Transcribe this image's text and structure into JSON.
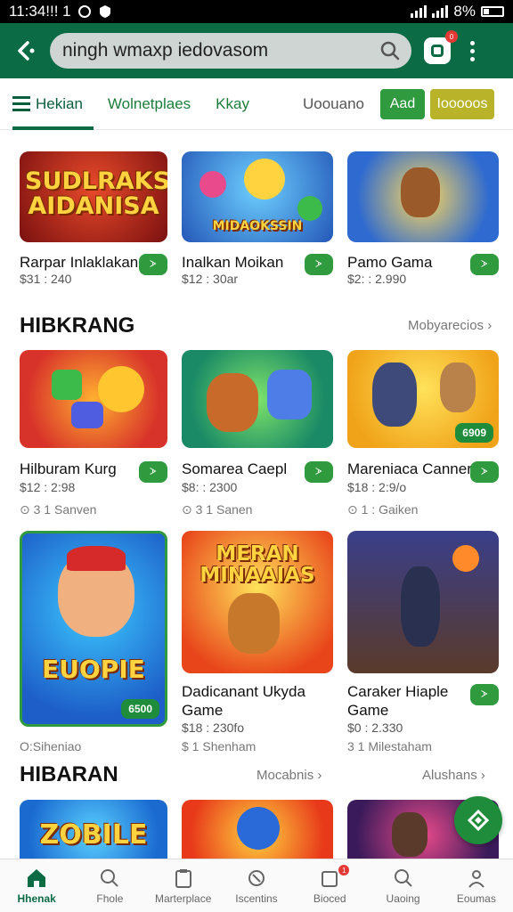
{
  "status_bar": {
    "time": "11:34!!! 1",
    "battery": "8%"
  },
  "search": {
    "value": "ningh wmaxp iedovasom"
  },
  "header": {
    "cart_badge": "0"
  },
  "tabs": [
    {
      "label": "Hekian"
    },
    {
      "label": "Wolnetplaes"
    },
    {
      "label": "Kkay"
    },
    {
      "label": "Uoouano"
    },
    {
      "label": "Aad"
    },
    {
      "label": "Iooooos"
    }
  ],
  "row1": [
    {
      "art": "SUDLRAKS AIDANISA",
      "title": "Rarpar Inlaklakan",
      "price": "$31 : 240",
      "get": "ᗆ"
    },
    {
      "art": "MIDAOKSSIN",
      "title": "Inalkan Moikan",
      "price": "$12 : 30ar",
      "get": "ᗆ"
    },
    {
      "art": "",
      "title": "Pamo Gama",
      "price": "$2: : 2.990",
      "get": "ᗆ"
    }
  ],
  "section_hibkrang": {
    "title": "HIBKRANG",
    "link": "Mobyarecios"
  },
  "row2": [
    {
      "title": "Hilburam Kurg",
      "price": "$12 : 2:98",
      "meta": "3 1 Sanven",
      "get": "ᗆ",
      "badge": ""
    },
    {
      "title": "Somarea Caepl",
      "price": "$8: : 2300",
      "meta": "3 1 Sanen",
      "get": "ᗆ",
      "badge": ""
    },
    {
      "title": "Mareniaca Canner",
      "price": "$18 : 2:9/o",
      "meta": "1 : Gaiken",
      "get": "ᗆ",
      "badge": "6909"
    }
  ],
  "row3": [
    {
      "art": "EUOPIE",
      "title": "",
      "price": "",
      "meta": "O:Siheniao",
      "get": "",
      "badge": "6500"
    },
    {
      "art": "MERAN MINAAIAS",
      "title": "Dadicanant Ukyda Game",
      "price": "$18 : 230fo",
      "meta": "$ 1 Shenham",
      "get": "",
      "badge": ""
    },
    {
      "art": "",
      "title": "Caraker Hiaple Game",
      "price": "$0 : 2.330",
      "meta": "3 1 Milestaham",
      "get": "ᗆ",
      "badge": ""
    }
  ],
  "section_hibaran": {
    "title": "HIBARAN",
    "link_mid": "Mocabnis",
    "link_right": "Alushans"
  },
  "row4": [
    {
      "art": "ZOBILE"
    },
    {
      "art": ""
    },
    {
      "art": ""
    }
  ],
  "bottom_nav": [
    {
      "label": "Hhenak",
      "badge": ""
    },
    {
      "label": "Fhole",
      "badge": ""
    },
    {
      "label": "Marterplace",
      "badge": ""
    },
    {
      "label": "Iscentins",
      "badge": ""
    },
    {
      "label": "Bioced",
      "badge": "1"
    },
    {
      "label": "Uaoing",
      "badge": ""
    },
    {
      "label": "Eoumas",
      "badge": ""
    }
  ]
}
